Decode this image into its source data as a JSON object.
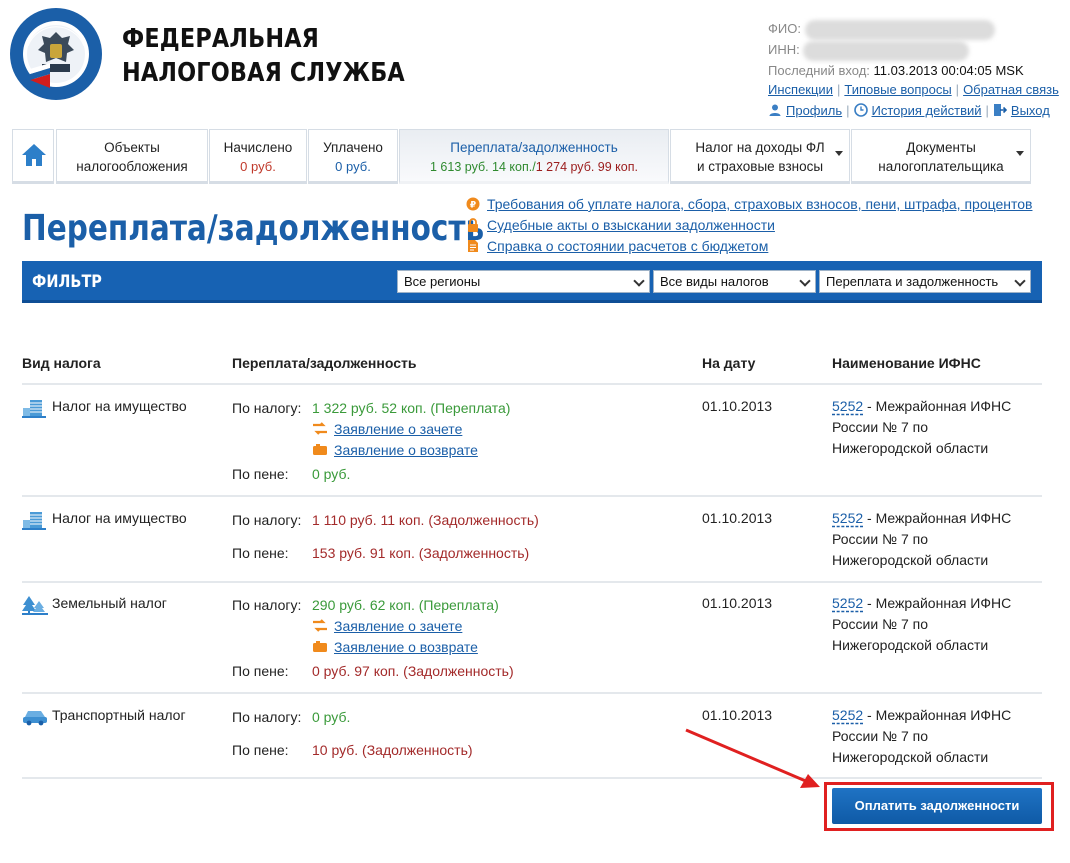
{
  "header": {
    "brand_line1": "ФЕДЕРАЛЬНАЯ",
    "brand_line2": "НАЛОГОВАЯ СЛУЖБА",
    "fio_label": "ФИО:",
    "inn_label": "ИНН:",
    "last_login_label": "Последний вход:",
    "last_login_value": "11.03.2013 00:04:05 MSK",
    "links": [
      "Инспекции",
      "Типовые вопросы",
      "Обратная связь"
    ],
    "profile": "Профиль",
    "history": "История действий",
    "logout": "Выход"
  },
  "tabs": [
    {
      "line1": "Объекты",
      "line2": "налогообложения"
    },
    {
      "line1": "Начислено",
      "line2": "0 руб."
    },
    {
      "line1": "Уплачено",
      "line2": "0 руб."
    },
    {
      "line1": "Переплата/задолженность",
      "line2_green": "1 613 руб. 14 коп.",
      "line2_slash": "/",
      "line2_red": "1 274 руб. 99 коп."
    },
    {
      "line1": "Налог на доходы ФЛ",
      "line2": "и страховые взносы"
    },
    {
      "line1": "Документы",
      "line2": "налогоплательщика"
    }
  ],
  "page": {
    "title": "Переплата/задолженность",
    "quick_links": [
      "Требования об уплате налога, сбора, страховых взносов, пени, штрафа, процентов",
      "Судебные акты о взыскании задолженности",
      "Справка о состоянии расчетов с бюджетом"
    ]
  },
  "filter": {
    "label": "ФИЛЬТР",
    "region": "Все регионы",
    "tax_type": "Все виды налогов",
    "mode": "Переплата и задолженность"
  },
  "table": {
    "headers": [
      "Вид налога",
      "Переплата/задолженность",
      "На дату",
      "Наименование ИФНС"
    ],
    "by_tax_label": "По налогу:",
    "by_penalty_label": "По пене:",
    "offset_link": "Заявление о зачете",
    "refund_link": "Заявление о возврате",
    "rows": [
      {
        "tax": "Налог на имущество",
        "tax_amount": "1 322 руб. 52 коп. (Переплата)",
        "penalty": "0 руб.",
        "date": "01.10.2013",
        "ifns_code": "5252",
        "ifns_l1": " - Межрайонная ИФНС",
        "ifns_l2": "России № 7 по",
        "ifns_l3": "Нижегородской области"
      },
      {
        "tax": "Налог на имущество",
        "tax_amount": "1 110 руб. 11 коп. (Задолженность)",
        "penalty": "153 руб. 91 коп. (Задолженность)",
        "date": "01.10.2013",
        "ifns_code": "5252",
        "ifns_l1": " - Межрайонная ИФНС",
        "ifns_l2": "России № 7 по",
        "ifns_l3": "Нижегородской области"
      },
      {
        "tax": "Земельный налог",
        "tax_amount": "290 руб. 62 коп. (Переплата)",
        "penalty": "0 руб. 97 коп. (Задолженность)",
        "date": "01.10.2013",
        "ifns_code": "5252",
        "ifns_l1": " - Межрайонная ИФНС",
        "ifns_l2": "России № 7 по",
        "ifns_l3": "Нижегородской области"
      },
      {
        "tax": "Транспортный налог",
        "tax_amount": "0 руб.",
        "penalty": "10 руб. (Задолженность)",
        "date": "01.10.2013",
        "ifns_code": "5252",
        "ifns_l1": " - Межрайонная ИФНС",
        "ifns_l2": "России № 7 по",
        "ifns_l3": "Нижегородской области"
      }
    ]
  },
  "pay_button": "Оплатить задолженности",
  "colors": {
    "accent": "#1762b3",
    "overpay": "#3a9a3a",
    "debt": "#a32a2a",
    "annotation": "#e02020"
  }
}
